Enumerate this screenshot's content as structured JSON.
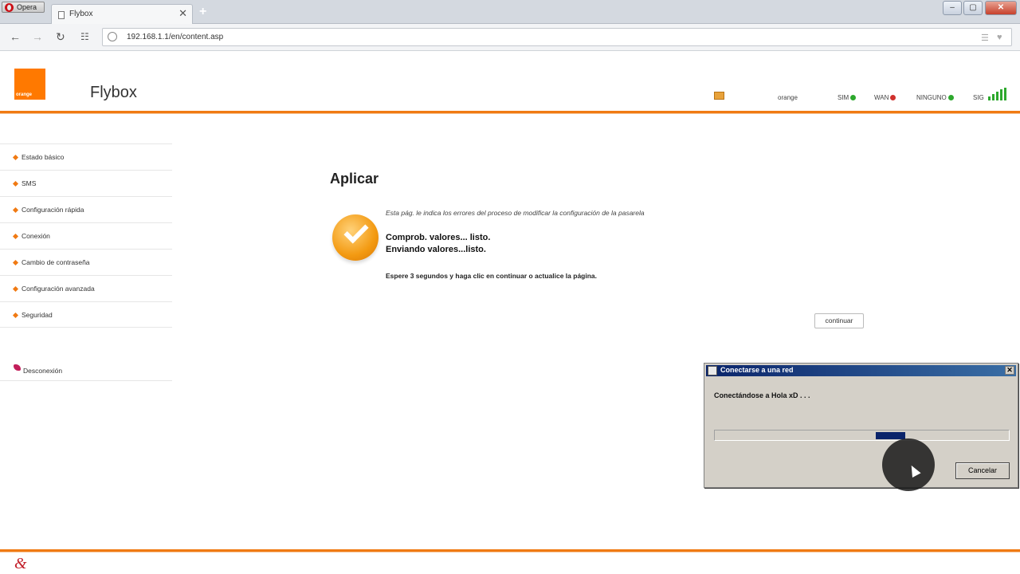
{
  "browser": {
    "menu_label": "Opera",
    "tab_title": "Flybox",
    "tab_close": "✕",
    "new_tab": "+",
    "url": "192.168.1.1/en/content.asp",
    "controls": {
      "minimize": "‒",
      "maximize": "▢",
      "close": "✕"
    }
  },
  "header": {
    "logo_text": "orange",
    "brand": "Flybox",
    "status": {
      "operator": "orange",
      "sim": "SIM",
      "wan": "WAN",
      "network": "NINGUNO",
      "signal": "SIG"
    },
    "colors": {
      "accent": "#f07a13",
      "ok": "#2da82d",
      "error": "#d0312d"
    }
  },
  "sidebar": {
    "items": [
      {
        "label": "Estado básico"
      },
      {
        "label": "SMS"
      },
      {
        "label": "Configuración rápida"
      },
      {
        "label": "Conexión"
      },
      {
        "label": "Cambio de contraseña"
      },
      {
        "label": "Configuración avanzada"
      },
      {
        "label": "Seguridad"
      }
    ],
    "disconnect": "Desconexión"
  },
  "main": {
    "title": "Aplicar",
    "description": "Esta pág. le indica los errores del proceso de modificar la configuración de la pasarela",
    "line1": "Comprob. valores... listo.",
    "line2": "Enviando valores...listo.",
    "wait": "Espere 3 segundos y haga clic en continuar o actualice la página.",
    "continue_button": "continuar"
  },
  "dialog": {
    "title": "Conectarse a una red",
    "close": "✕",
    "message": "Conectándose a Hola xD . . .",
    "progress_segment": {
      "start": 0.55,
      "end": 0.65
    },
    "cancel_button": "Cancelar"
  }
}
